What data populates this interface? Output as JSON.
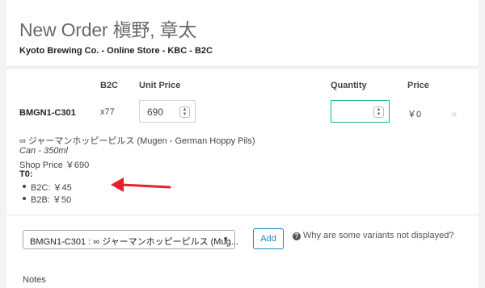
{
  "header": {
    "title": "New Order 槇野, 章太",
    "subtitle": "Kyoto Brewing Co. - Online Store - KBC - B2C"
  },
  "table": {
    "col_b2c": "B2C",
    "col_unit_price": "Unit Price",
    "col_quantity": "Quantity",
    "col_price": "Price"
  },
  "line_item": {
    "sku": "BMGN1-C301",
    "multiplier": "x77",
    "unit_price_value": "690",
    "quantity_value": "",
    "price": "￥0",
    "remove_glyph": "×"
  },
  "product": {
    "name": "∞ ジャーマンホッピーピルス (Mugen - German Hoppy Pils)",
    "size": "Can - 350ml",
    "shop_price": "Shop Price ￥690",
    "tier_label": "T0:",
    "tiers": [
      "B2C: ￥45",
      "B2B: ￥50"
    ]
  },
  "annotation": {
    "arrow_color": "#e8202c"
  },
  "add_variant": {
    "selected": "BMGN1-C301 : ∞ ジャーマンホッピーピルス (Mug...",
    "add_label": "Add",
    "help_text": "Why are some variants not displayed?"
  },
  "notes_label": "Notes",
  "colors": {
    "accent_green": "#1ab394",
    "link_blue": "#1c84c6"
  }
}
